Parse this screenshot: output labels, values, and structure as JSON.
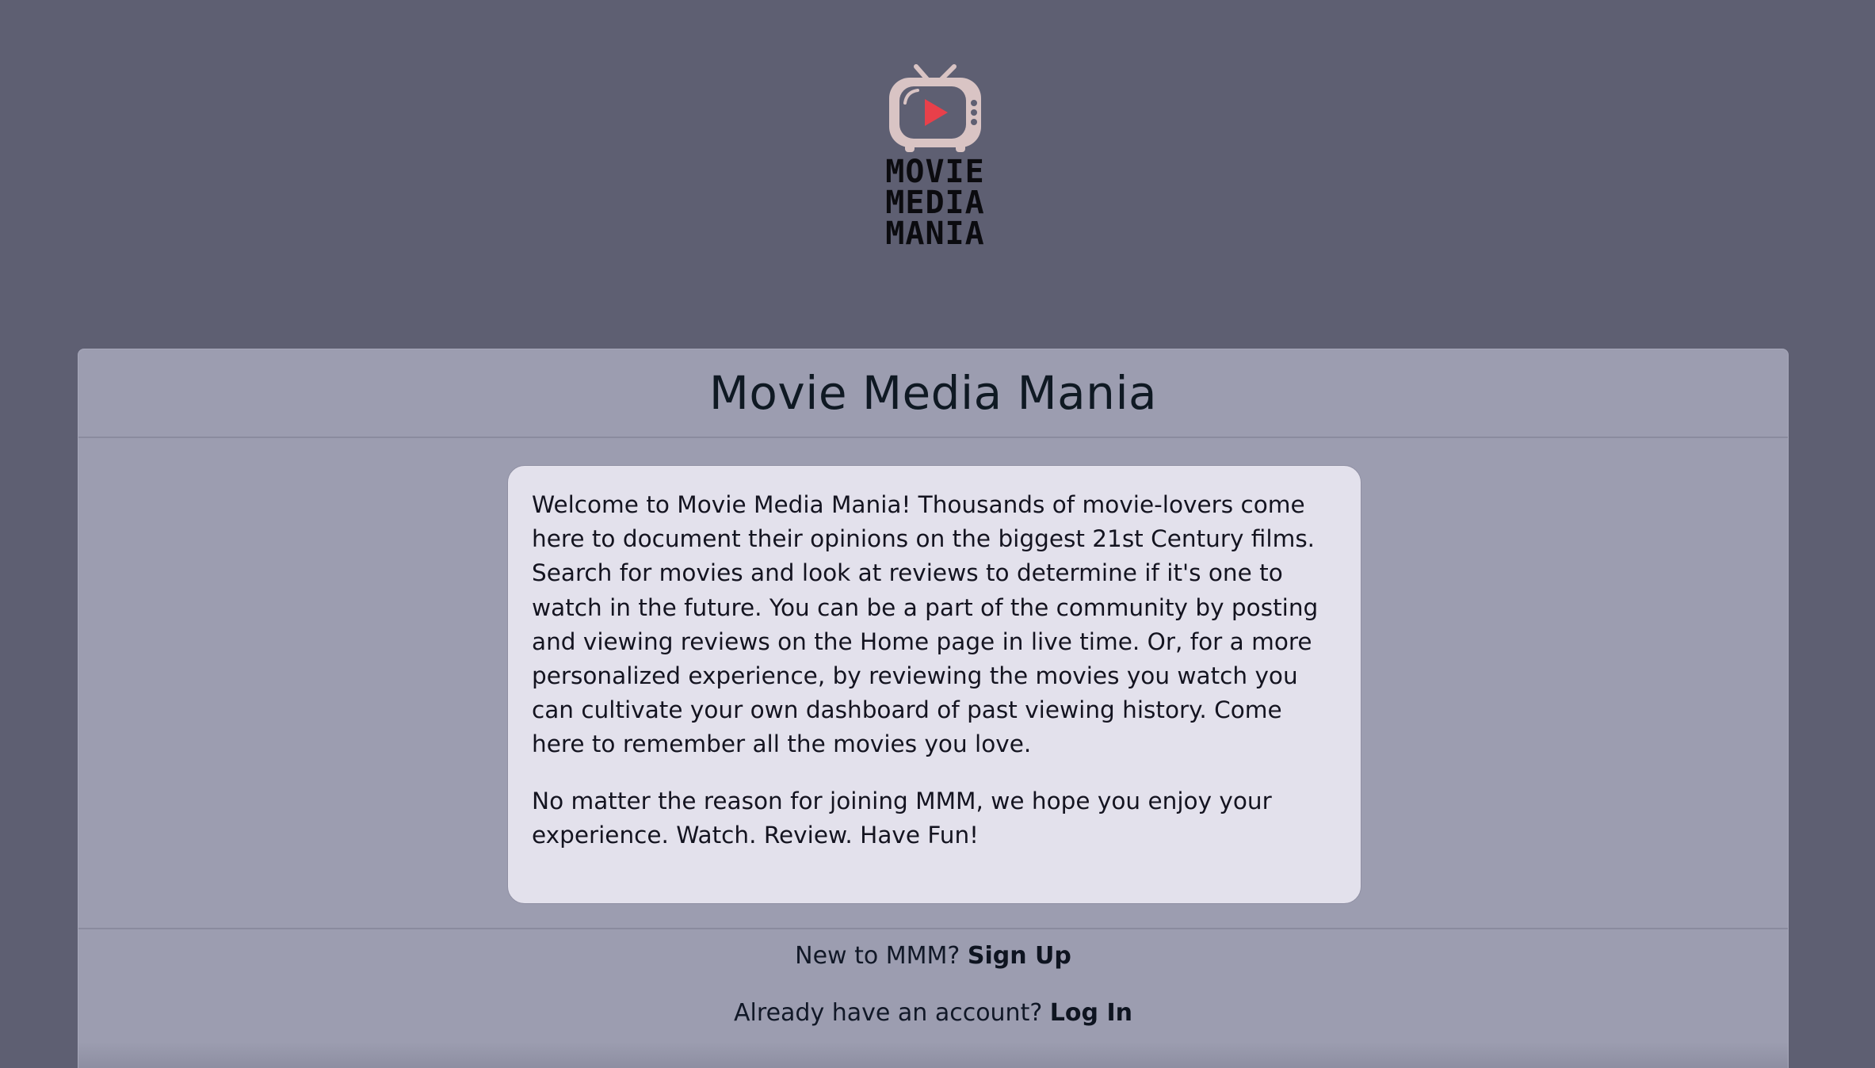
{
  "logo": {
    "icon": "tv-play-icon",
    "lines": [
      "MOVIE",
      "MEDIA",
      "MANIA"
    ]
  },
  "card": {
    "title": "Movie Media Mania",
    "paragraphs": [
      "Welcome to Movie Media Mania! Thousands of movie-lovers come here to document their opinions on the biggest 21st Century films. Search for movies and look at reviews to determine if it's one to watch in the future. You can be a part of the community by posting and viewing reviews on the Home page in live time. Or, for a more personalized experience, by reviewing the movies you watch you can cultivate your own dashboard of past viewing history. Come here to remember all the movies you love.",
      "No matter the reason for joining MMM, we hope you enjoy your experience. Watch. Review. Have Fun!"
    ],
    "footer": {
      "signup_prompt": "New to MMM? ",
      "signup_link": "Sign Up",
      "login_prompt": "Already have an account? ",
      "login_link": "Log In"
    }
  },
  "colors": {
    "background": "#5e5f72",
    "card": "#9c9db0",
    "welcome_box": "#e3e1ec",
    "logo_tv": "#d9c4c4",
    "logo_play": "#e8404a"
  }
}
